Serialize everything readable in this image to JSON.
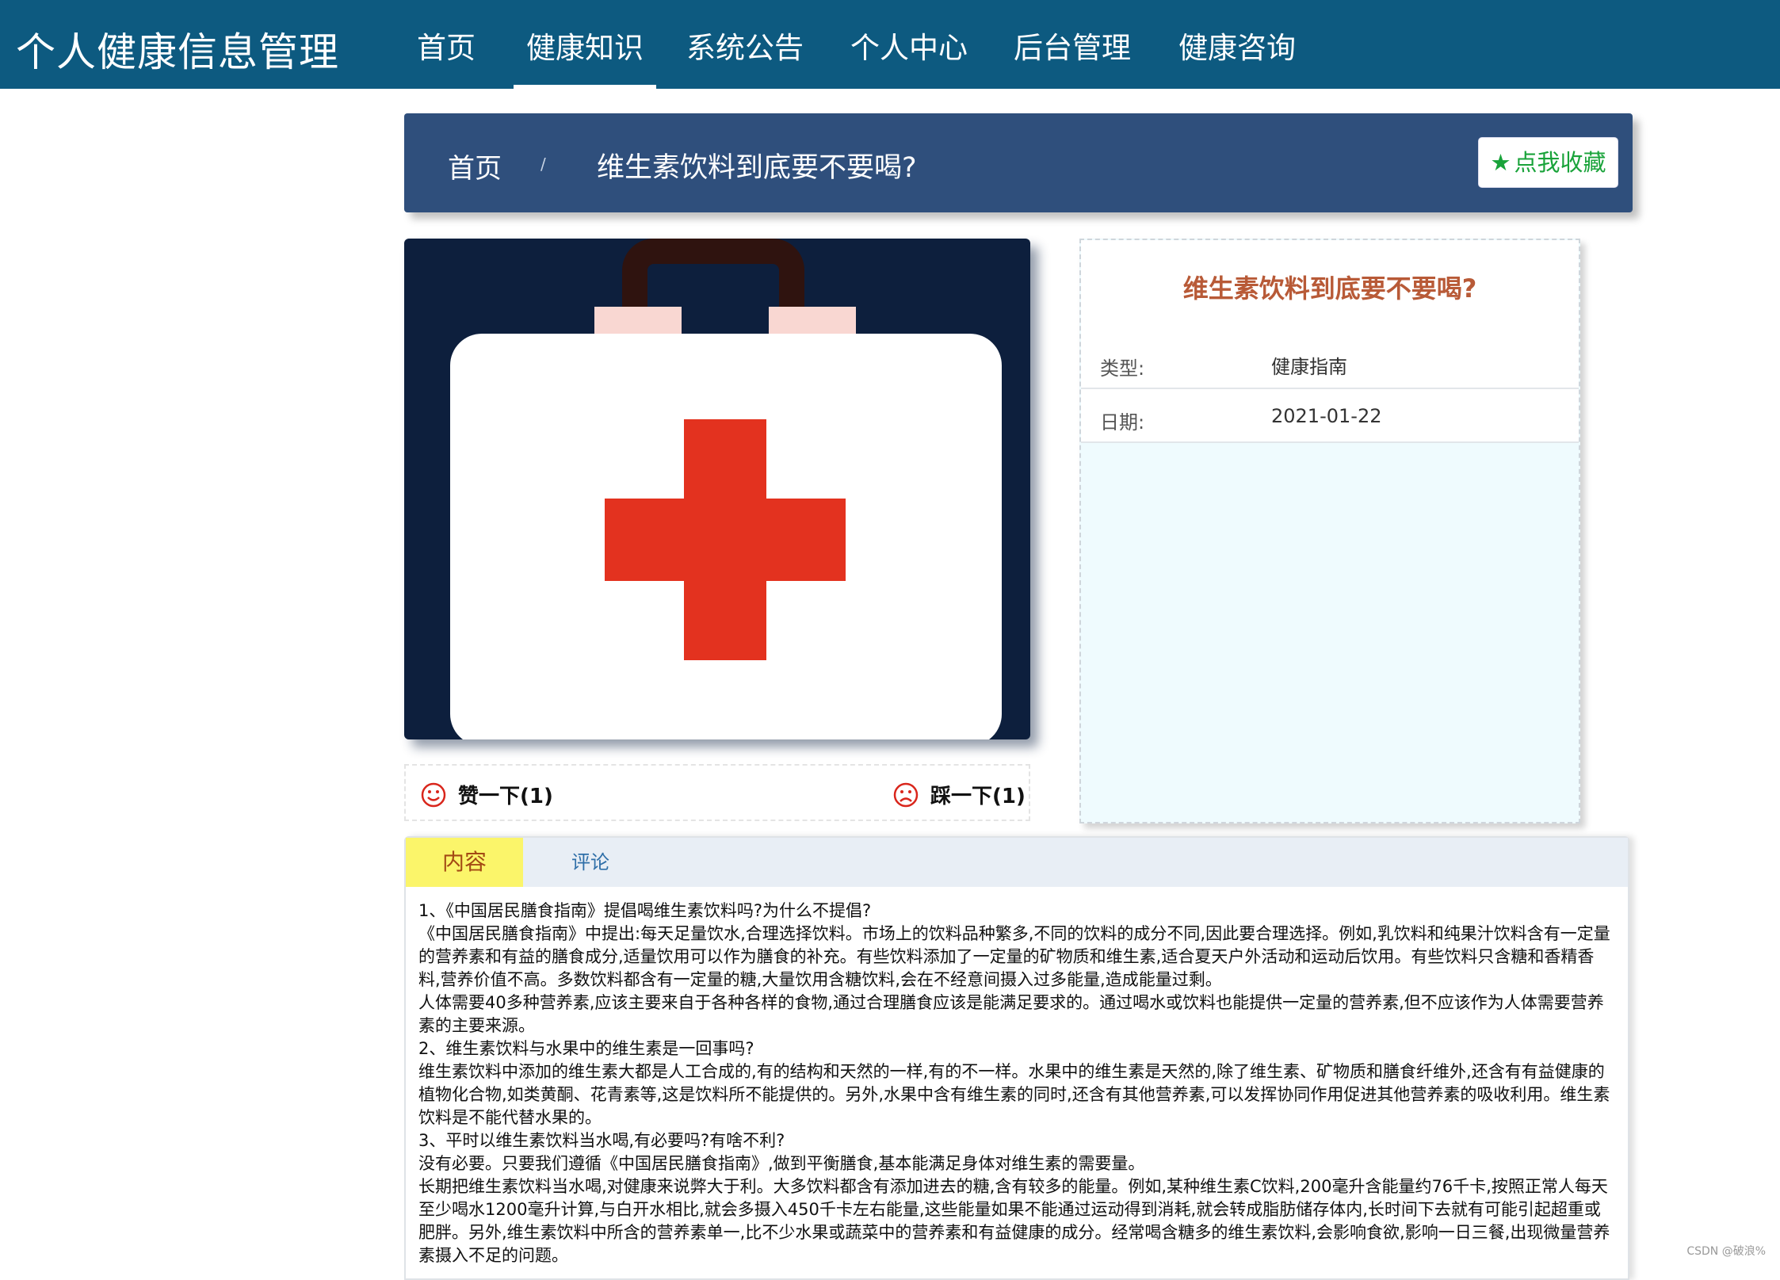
{
  "app": {
    "brand": "个人健康信息管理"
  },
  "nav": {
    "items": [
      {
        "label": "首页"
      },
      {
        "label": "健康知识",
        "active": true
      },
      {
        "label": "系统公告"
      },
      {
        "label": "个人中心"
      },
      {
        "label": "后台管理"
      },
      {
        "label": "健康咨询"
      }
    ]
  },
  "breadcrumb": {
    "home": "首页",
    "separator": "/",
    "current": "维生素饮料到底要不要喝?"
  },
  "favorite": {
    "label": "点我收藏",
    "icon": "star-icon"
  },
  "image": {
    "icon": "first-aid-kit-icon"
  },
  "vote": {
    "like_label": "赞一下(1)",
    "dislike_label": "踩一下(1)"
  },
  "info": {
    "title": "维生素饮料到底要不要喝?",
    "type_label": "类型:",
    "type_value": "健康指南",
    "date_label": "日期:",
    "date_value": "2021-01-22"
  },
  "tabs": {
    "content": "内容",
    "comment": "评论"
  },
  "article": {
    "paragraphs": [
      "1、《中国居民膳食指南》提倡喝维生素饮料吗?为什么不提倡?",
      "《中国居民膳食指南》中提出:每天足量饮水,合理选择饮料。市场上的饮料品种繁多,不同的饮料的成分不同,因此要合理选择。例如,乳饮料和纯果汁饮料含有一定量的营养素和有益的膳食成分,适量饮用可以作为膳食的补充。有些饮料添加了一定量的矿物质和维生素,适合夏天户外活动和运动后饮用。有些饮料只含糖和香精香料,营养价值不高。多数饮料都含有一定量的糖,大量饮用含糖饮料,会在不经意间摄入过多能量,造成能量过剩。",
      "人体需要40多种营养素,应该主要来自于各种各样的食物,通过合理膳食应该是能满足要求的。通过喝水或饮料也能提供一定量的营养素,但不应该作为人体需要营养素的主要来源。",
      "2、维生素饮料与水果中的维生素是一回事吗?",
      "维生素饮料中添加的维生素大都是人工合成的,有的结构和天然的一样,有的不一样。水果中的维生素是天然的,除了维生素、矿物质和膳食纤维外,还含有有益健康的植物化合物,如类黄酮、花青素等,这是饮料所不能提供的。另外,水果中含有维生素的同时,还含有其他营养素,可以发挥协同作用促进其他营养素的吸收利用。维生素饮料是不能代替水果的。",
      "3、平时以维生素饮料当水喝,有必要吗?有啥不利?",
      "没有必要。只要我们遵循《中国居民膳食指南》,做到平衡膳食,基本能满足身体对维生素的需要量。",
      "长期把维生素饮料当水喝,对健康来说弊大于利。大多饮料都含有添加进去的糖,含有较多的能量。例如,某种维生素C饮料,200毫升含能量约76千卡,按照正常人每天至少喝水1200毫升计算,与白开水相比,就会多摄入450千卡左右能量,这些能量如果不能通过运动得到消耗,就会转成脂肪储存体内,长时间下去就有可能引起超重或肥胖。另外,维生素饮料中所含的营养素单一,比不少水果或蔬菜中的营养素和有益健康的成分。经常喝含糖多的维生素饮料,会影响食欲,影响一日三餐,出现微量营养素摄入不足的问题。"
    ]
  },
  "watermark": "CSDN @破浪%",
  "colors": {
    "nav_bg": "#0d5a80",
    "crumb_bg": "#2f4f7c",
    "accent_green": "#19a33a",
    "title_orange": "#b85a37",
    "tab_yellow": "#fbf56a",
    "cross_red": "#e3321f"
  }
}
